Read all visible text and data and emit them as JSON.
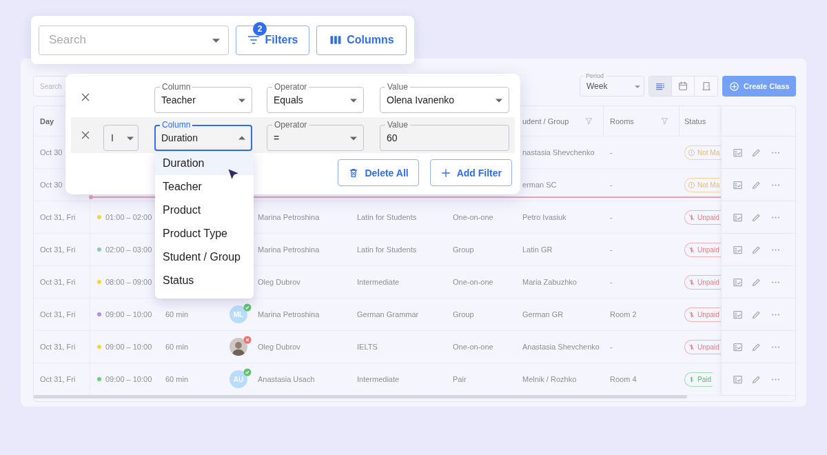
{
  "toolbar": {
    "search": {
      "placeholder": "Search"
    },
    "filters_button": {
      "label": "Filters",
      "badge": "2"
    },
    "columns_button": {
      "label": "Columns"
    }
  },
  "page_toolbar": {
    "search": {
      "placeholder": "Search"
    },
    "period": {
      "label": "Period",
      "value": "Week"
    },
    "view_modes": [
      {
        "kind": "list",
        "selected": true
      },
      {
        "kind": "calendar",
        "selected": false
      },
      {
        "kind": "room",
        "selected": false
      }
    ],
    "create_button": {
      "label": "Create Class"
    }
  },
  "table": {
    "columns": [
      {
        "kind": "day",
        "label": "Day",
        "filterable": false
      },
      {
        "kind": "student",
        "label": "udent / Group",
        "filterable": true
      },
      {
        "kind": "rooms",
        "label": "Rooms",
        "filterable": true
      },
      {
        "kind": "status",
        "label": "Status",
        "filterable": false
      }
    ],
    "rows": [
      {
        "day": "Oct 30",
        "student": "nastasia Shevchenko",
        "room": "-",
        "status": {
          "kind": "warning",
          "label": "Not Ma"
        }
      },
      {
        "day": "Oct 30",
        "student": "erman SC",
        "room": "-",
        "status": {
          "kind": "warning",
          "label": "Not Ma"
        }
      },
      {
        "day": "Oct 31, Fri",
        "time": "01:00 – 02:00",
        "color": "#f5d442",
        "teacher": "Marina Petroshina",
        "product": "Latin for Students",
        "product_type": "One-on-one",
        "student": "Petro Ivasiuk",
        "room": "-",
        "status": {
          "kind": "unpaid",
          "label": "Unpaid"
        }
      },
      {
        "day": "Oct 31, Fri",
        "time": "02:00 – 03:00",
        "color": "#8fc9b0",
        "teacher": "Marina Petroshina",
        "product": "Latin for Students",
        "product_type": "Group",
        "student": "Latin GR",
        "room": "-",
        "status": {
          "kind": "unpaid",
          "label": "Unpaid"
        }
      },
      {
        "day": "Oct 31, Fri",
        "time": "08:00 – 09:00",
        "color": "#f5d442",
        "teacher": "Oleg Dubrov",
        "product": "Intermediate",
        "product_type": "One-on-one",
        "student": "Maria Zabuzhko",
        "room": "-",
        "status": {
          "kind": "unpaid",
          "label": "Unpaid"
        }
      },
      {
        "day": "Oct 31, Fri",
        "time": "09:00 – 10:00",
        "color": "#b48cf5",
        "duration": "60 min",
        "avatar": {
          "kind": "initials",
          "initials": "ML",
          "confirmed": true
        },
        "teacher": "Marina Petroshina",
        "product": "German Grammar",
        "product_type": "Group",
        "student": "German GR",
        "room": "Room 2",
        "status": {
          "kind": "unpaid",
          "label": "Unpaid"
        }
      },
      {
        "day": "Oct 31, Fri",
        "time": "09:00 – 10:00",
        "color": "#f5d442",
        "duration": "60 min",
        "avatar": {
          "kind": "photo",
          "confirmed": false
        },
        "teacher": "Oleg Dubrov",
        "product": "IELTS",
        "product_type": "One-on-one",
        "student": "Anastasia Shevchenko",
        "room": "-",
        "status": {
          "kind": "unpaid",
          "label": "Unpaid"
        }
      },
      {
        "day": "Oct 31, Fri",
        "time": "09:00 – 10:00",
        "color": "#6cd46c",
        "duration": "60 min",
        "avatar": {
          "kind": "initials",
          "initials": "AU",
          "confirmed": true
        },
        "teacher": "Anastasia Usach",
        "product": "Intermediate",
        "product_type": "Pair",
        "student": "Melnik / Rozhko",
        "room": "Room 4",
        "status": {
          "kind": "paid",
          "label": "Paid"
        }
      }
    ]
  },
  "filter_panel": {
    "filters": [
      {
        "active": false,
        "fields": [
          {
            "label": "Column",
            "value": "Teacher",
            "kind": "select",
            "focused": false
          },
          {
            "label": "Operator",
            "value": "Equals",
            "kind": "select",
            "focused": false
          },
          {
            "label": "Value",
            "value": "Olena Ivanenko",
            "kind": "select",
            "focused": false
          }
        ]
      },
      {
        "active": true,
        "logic": "I",
        "fields": [
          {
            "label": "Column",
            "value": "Duration",
            "kind": "select",
            "focused": true
          },
          {
            "label": "Operator",
            "value": "=",
            "kind": "select",
            "focused": false
          },
          {
            "label": "Value",
            "value": "60",
            "kind": "text",
            "focused": false
          }
        ]
      }
    ],
    "actions": [
      {
        "label": "Delete All",
        "kind": "delete"
      },
      {
        "label": "Add Filter",
        "kind": "add"
      }
    ]
  },
  "column_dropdown": {
    "options": [
      {
        "label": "Duration",
        "selected": true
      },
      {
        "label": "Teacher",
        "selected": false
      },
      {
        "label": "Product",
        "selected": false
      },
      {
        "label": "Product Type",
        "selected": false
      },
      {
        "label": "Student / Group",
        "selected": false
      },
      {
        "label": "Status",
        "selected": false
      }
    ]
  }
}
